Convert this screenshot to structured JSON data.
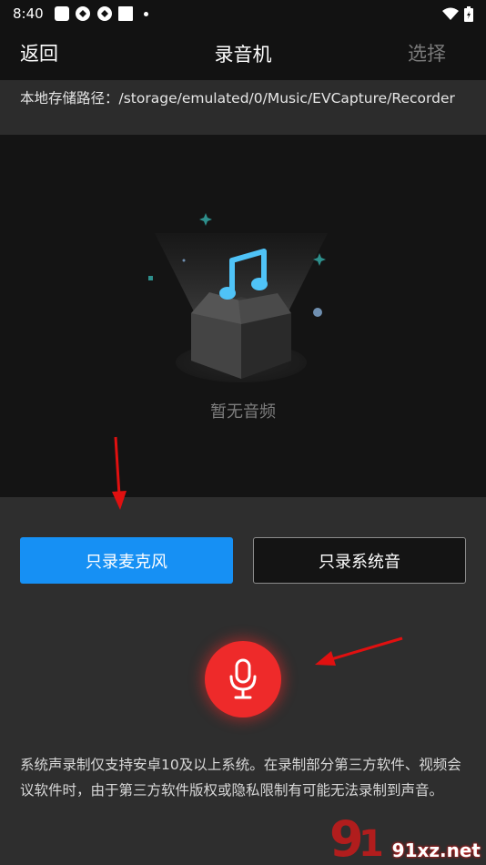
{
  "status_bar": {
    "time": "8:40"
  },
  "header": {
    "back_label": "返回",
    "title": "录音机",
    "select_label": "选择"
  },
  "path_bar": {
    "text": "本地存储路径：/storage/emulated/0/Music/EVCapture/Recorder"
  },
  "empty_state": {
    "text": "暂无音频",
    "icon": "music-box-icon"
  },
  "modes": {
    "mic_only_label": "只录麦克风",
    "system_only_label": "只录系统音",
    "selected": "mic_only"
  },
  "record_button": {
    "icon": "microphone-icon"
  },
  "notice": {
    "text": "系统声录制仅支持安卓10及以上系统。在录制部分第三方软件、视频会议软件时，由于第三方软件版权或隐私限制有可能无法录制到声音。"
  },
  "watermark": {
    "text": "91xz.net"
  },
  "colors": {
    "accent_blue": "#1690f4",
    "record_red": "#ee2a2a",
    "arrow_red": "#e01010",
    "music_note_cyan": "#4fc3f7"
  }
}
